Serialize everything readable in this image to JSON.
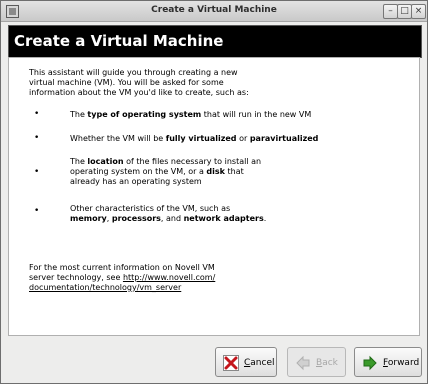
{
  "window": {
    "title": "Create a Virtual Machine",
    "controls": {
      "minimize": "–",
      "maximize": "□",
      "close": "×"
    }
  },
  "banner": {
    "heading": "Create a Virtual Machine"
  },
  "intro": {
    "line1": "This assistant will guide you through creating a new",
    "line2": "virtual machine (VM).  You will be asked for some",
    "line3": "information about the VM you'd like to create, such as:"
  },
  "bullets": {
    "b1": {
      "pre": "The ",
      "bold": "type of operating system",
      "post": " that will run in the new VM"
    },
    "b2": {
      "pre": "Whether the VM will be ",
      "bold1": "fully virtualized",
      "mid": " or ",
      "bold2": "paravirtualized"
    },
    "b3": {
      "l1_pre": "The ",
      "l1_bold": "location",
      "l1_post": " of the files necessary to install an",
      "l2_pre": "operating system on the VM, or a ",
      "l2_bold": "disk",
      "l2_post": " that",
      "l3": "already has an operating system"
    },
    "b4": {
      "l1": "Other characteristics of the VM, such as",
      "l2_bold1": "memory",
      "sep1": ", ",
      "l2_bold2": "processors",
      "sep2": ", and ",
      "l2_bold3": "network adapters",
      "end": "."
    },
    "marker": "•"
  },
  "footer": {
    "line1": "For the most current information on Novell VM",
    "line2_pre": "server technology, see ",
    "link1": "http://www.novell.com/",
    "link2": "documentation/technology/vm_server"
  },
  "buttons": {
    "cancel": {
      "mnemonic": "C",
      "rest": "ancel",
      "icon": "cancel-x-icon",
      "enabled": true
    },
    "back": {
      "mnemonic": "B",
      "rest": "ack",
      "icon": "back-arrow-icon",
      "enabled": false
    },
    "forward": {
      "mnemonic": "F",
      "rest": "orward",
      "icon": "forward-arrow-icon",
      "enabled": true
    }
  },
  "colors": {
    "banner_bg": "#000000",
    "banner_text": "#ffffff",
    "forward_icon": "#3a9a2a",
    "cancel_icon": "#c4161c"
  }
}
